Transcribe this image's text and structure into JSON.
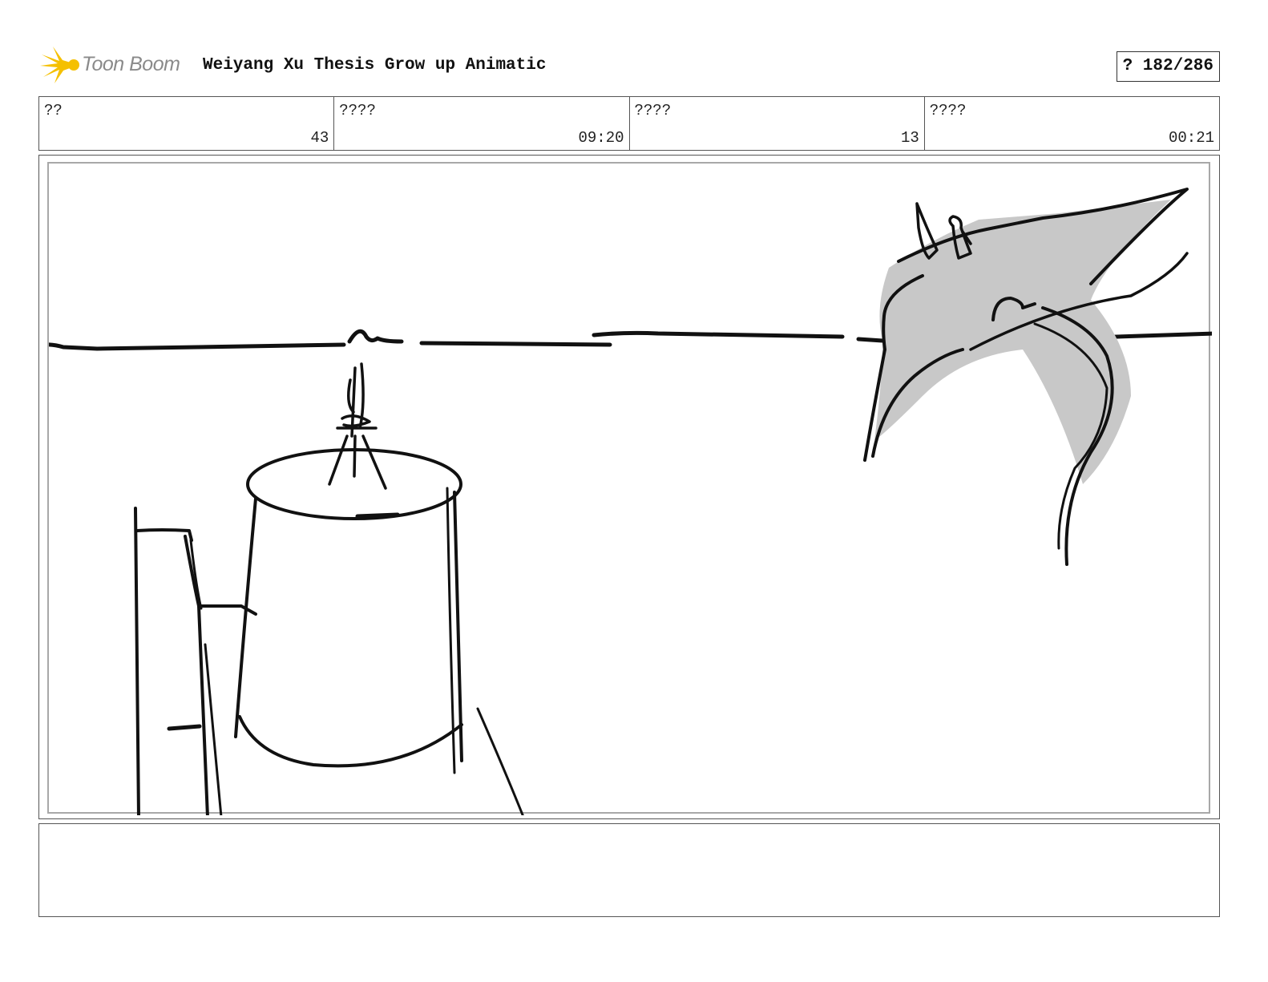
{
  "header": {
    "logo_text": "Toon Boom",
    "project_title": "Weiyang Xu Thesis Grow up Animatic",
    "page_counter": "? 182/286"
  },
  "info": [
    {
      "label": "??",
      "value": "43"
    },
    {
      "label": "????",
      "value": "09:20"
    },
    {
      "label": "????",
      "value": "13"
    },
    {
      "label": "????",
      "value": "00:21"
    }
  ],
  "notes": {
    "text": ""
  },
  "colors": {
    "logo_accent": "#f5c000",
    "logo_text": "#8a8a8a",
    "sketch_line": "#111111",
    "sketch_fill": "#c8c8c8"
  }
}
